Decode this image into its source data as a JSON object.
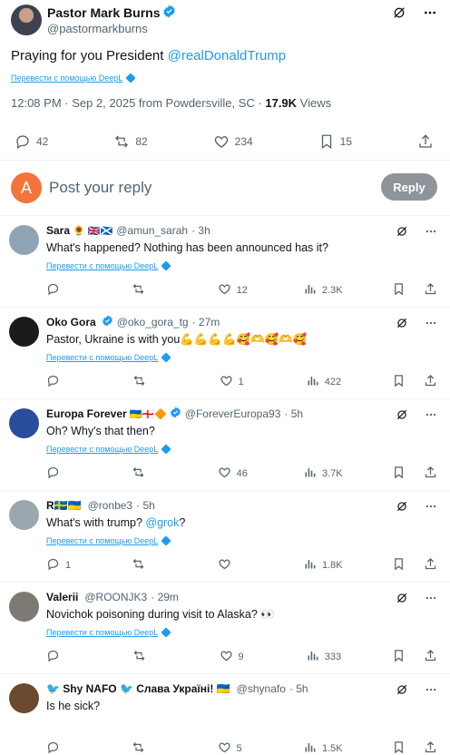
{
  "main_post": {
    "name": "Pastor Mark Burns",
    "handle": "@pastormarkburns",
    "text": "Praying for you President ",
    "mention": "@realDonaldTrump",
    "translate": "Перевести с помощью DeepL",
    "meta_time": "12:08 PM · Sep 2, 2025 from Powdersville, SC · ",
    "views_count": "17.9K",
    "views_label": " Views",
    "stats": {
      "replies": "42",
      "reposts": "82",
      "likes": "234",
      "bookmarks": "15"
    }
  },
  "reply_box": {
    "avatar_letter": "A",
    "placeholder": "Post your reply",
    "button": "Reply"
  },
  "replies": [
    {
      "name": "Sara",
      "emoji": "🌻 🇬🇧🏴󠁧󠁢󠁳󠁣󠁴󠁿",
      "handle": "@amun_sarah",
      "time": "· 3h",
      "text": "What's happened? Nothing has been announced has it?",
      "translate": "Перевести с помощью DeepL",
      "replies": "",
      "reposts": "",
      "likes": "12",
      "views": "2.3K",
      "avatar_color": "#8fa3b5"
    },
    {
      "name": "Oko Gora",
      "emoji": "",
      "handle": "@oko_gora_tg",
      "time": "· 27m",
      "text": "Pastor, Ukraine is with you💪💪💪💪🥰🫶🥰🫶🥰",
      "translate": "Перевести с помощью DeepL",
      "replies": "",
      "reposts": "",
      "likes": "1",
      "views": "422",
      "avatar_color": "#1b1b1b"
    },
    {
      "name": "Europa Forever",
      "emoji": "🇺🇦🏴󠁧󠁢󠁥󠁮󠁧󠁿🔶",
      "handle": "@ForeverEuropa93",
      "time": "· 5h",
      "text": "Oh? Why's that then?",
      "translate": "Перевести с помощью DeepL",
      "replies": "",
      "reposts": "",
      "likes": "46",
      "views": "3.7K",
      "avatar_color": "#2a4c9c"
    },
    {
      "name": "R🇸🇪🇺🇦",
      "emoji": "",
      "handle": "@ronbe3",
      "time": "· 5h",
      "text": "What's with trump? ",
      "mention": "@grok",
      "text_after": "?",
      "translate": "Перевести с помощью DeepL",
      "replies": "1",
      "reposts": "",
      "likes": "",
      "views": "1.8K",
      "avatar_color": "#9aa7ae"
    },
    {
      "name": "Valerii",
      "emoji": "",
      "handle": "@ROONJK3",
      "time": "· 29m",
      "text": "Novichok poisoning during visit to Alaska? 👀",
      "translate": "Перевести с помощью DeepL",
      "replies": "",
      "reposts": "",
      "likes": "9",
      "views": "333",
      "avatar_color": "#7d7a74"
    },
    {
      "name": "🐦 Shy NAFO 🐦 Слава Україні! 🇺🇦",
      "emoji": "",
      "handle": "@shynafo",
      "time": "· 5h",
      "text": "Is he sick?",
      "translate": "",
      "replies": "",
      "reposts": "",
      "likes": "5",
      "views": "1.5K",
      "avatar_color": "#6b4a2f"
    }
  ],
  "colors": {
    "accent": "#1d9bf0",
    "muted": "#536471",
    "reply_avatar": "#f4743b"
  }
}
